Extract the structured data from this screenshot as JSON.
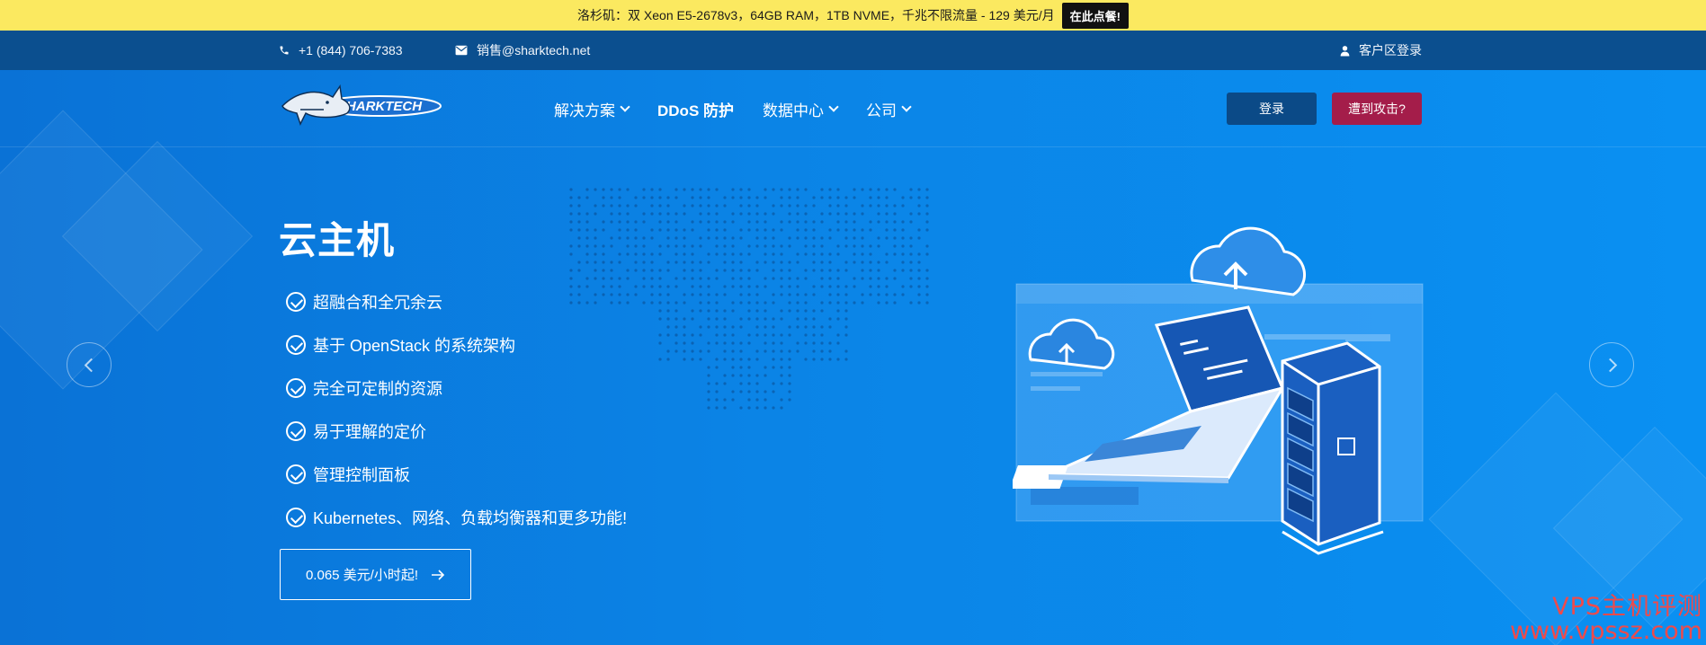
{
  "announcement": {
    "text": "洛杉矶：双 Xeon E5-2678v3，64GB RAM，1TB NVME，千兆不限流量 - 129 美元/月",
    "cta": "在此点餐!"
  },
  "topbar": {
    "phone_icon": "phone-icon",
    "phone": "+1 (844) 706-7383",
    "mail_icon": "envelope-icon",
    "email": "销售@sharktech.net",
    "client_icon": "user-icon",
    "client_login": "客户区登录"
  },
  "nav": {
    "logo_text": "SHARKTECH",
    "items": [
      {
        "label": "解决方案",
        "dropdown": true
      },
      {
        "label": "DDoS 防护",
        "dropdown": false
      },
      {
        "label": "数据中心",
        "dropdown": true
      },
      {
        "label": "公司",
        "dropdown": true
      }
    ],
    "login": "登录",
    "attack": "遭到攻击?"
  },
  "hero": {
    "title": "云主机",
    "features": [
      "超融合和全冗余云",
      "基于 OpenStack 的系统架构",
      "完全可定制的资源",
      "易于理解的定价",
      "管理控制面板",
      "Kubernetes、网络、负载均衡器和更多功能!"
    ],
    "button": "0.065 美元/小时起!",
    "button_icon": "arrow-right-icon"
  },
  "carousel": {
    "prev_icon": "chevron-left-icon",
    "next_icon": "chevron-right-icon"
  },
  "watermark": {
    "line1": "VPS主机评测",
    "line2": "www.vpssz.com"
  },
  "colors": {
    "announce_bg": "#fbe960",
    "topbar_bg": "#0b4f8f",
    "hero_bg": "#0a84e6",
    "login_bg": "#0b4a87",
    "attack_bg": "#a41d4a"
  }
}
